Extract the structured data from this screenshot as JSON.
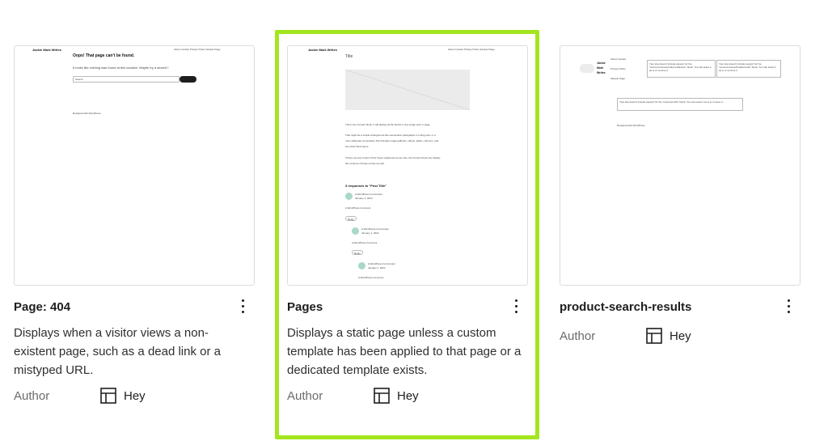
{
  "cards": [
    {
      "title": "Page: 404",
      "description": "Displays when a visitor views a non-existent page, such as a dead link or a mistyped URL.",
      "author_label": "Author",
      "author_name": "Hey",
      "preview": {
        "site_name": "Jackie Mark Writes",
        "nav": "About   Contact   Privacy Policy   Sample Page",
        "heading": "Oops! That page can't be found.",
        "message": "It looks like nothing was found at this location. Maybe try a search?",
        "search_placeholder": "Search",
        "footer": "Designed with WordPress"
      }
    },
    {
      "title": "Pages",
      "description": "Displays a static page unless a custom template has been applied to that page or a dedicated template exists.",
      "author_label": "Author",
      "author_name": "Hey",
      "selected": true,
      "preview": {
        "site_name": "Jackie Mark Writes",
        "nav": "About   Contact   Privacy Policy   Sample Page",
        "page_title": "Title",
        "p1": "This is the Content block, it will display all the blocks in any single post or page.",
        "p2a": "That might be a simple arrangement like consecutive paragraphs in a blog post, or a",
        "p2b": "more elaborate composition that includes image galleries, videos, tables, columns, and",
        "p2c": "any other block types.",
        "p3a": "If there are any Custom Post Types registered at your site, the Content block can display",
        "p3b": "the contents of those entries as well.",
        "responses": "3 responses to \"Post Title\"",
        "comment_author": "A WordPress Commenter",
        "comment_date": "January 1, 2024",
        "comment_text": "A WordPress Comment",
        "reply": "Reply"
      }
    },
    {
      "title": "product-search-results",
      "author_label": "Author",
      "author_name": "Hey",
      "preview": {
        "site_name_1": "Jackie",
        "site_name_2": "Mark",
        "site_name_3": "Writes",
        "nav_1": "About   Contact",
        "nav_2": "Privacy Policy",
        "nav_3": "Sample Page",
        "notice_1": "Your site doesn't include support for the \"woocommerce/product-collection\" block. You can leave it as is or remove it.",
        "notice_2": "Your site doesn't include support for the \"woocommerce/breadcrumbs\" block. You can leave it as is or remove it.",
        "notice_3": "Your site doesn't include support for the \"core/post-title\" block. You can leave it as is or remove it.",
        "footer": "Designed with WordPress"
      }
    }
  ],
  "colors": {
    "selection": "#a3e61f",
    "title": "#1e1e1e",
    "muted": "#6b6b6b"
  },
  "icons": {
    "menu": "vertical-ellipsis-icon",
    "template": "layout-icon"
  }
}
